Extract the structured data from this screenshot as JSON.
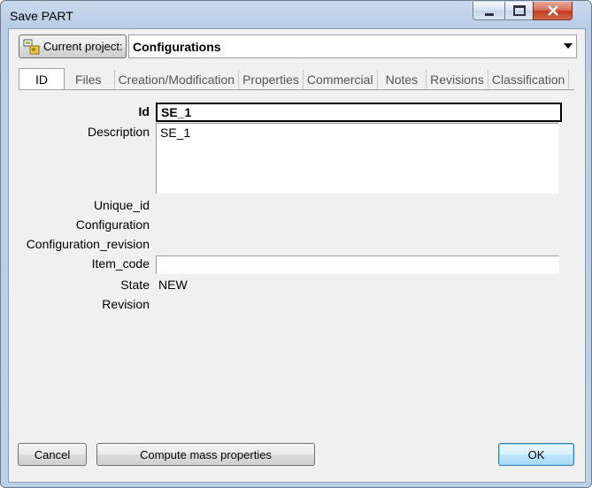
{
  "window": {
    "title": "Save  PART"
  },
  "toolbar": {
    "project_label": "Current project:",
    "project_value": "Configurations"
  },
  "tabs": [
    {
      "label": "ID",
      "active": true
    },
    {
      "label": "Files"
    },
    {
      "label": "Creation/Modification"
    },
    {
      "label": "Properties"
    },
    {
      "label": "Commercial"
    },
    {
      "label": "Notes"
    },
    {
      "label": "Revisions"
    },
    {
      "label": "Classification"
    }
  ],
  "fields": {
    "id_label": "Id",
    "id_value": "SE_1",
    "description_label": "Description",
    "description_value": "SE_1",
    "unique_id_label": "Unique_id",
    "configuration_label": "Configuration",
    "configuration_revision_label": "Configuration_revision",
    "item_code_label": "Item_code",
    "item_code_value": "",
    "state_label": "State",
    "state_value": "NEW",
    "revision_label": "Revision"
  },
  "buttons": {
    "cancel": "Cancel",
    "compute": "Compute mass properties",
    "ok": "OK"
  },
  "icons": {
    "project": "project-folder-icon",
    "minimize": "minimize-icon",
    "maximize": "maximize-icon",
    "close": "close-icon"
  }
}
